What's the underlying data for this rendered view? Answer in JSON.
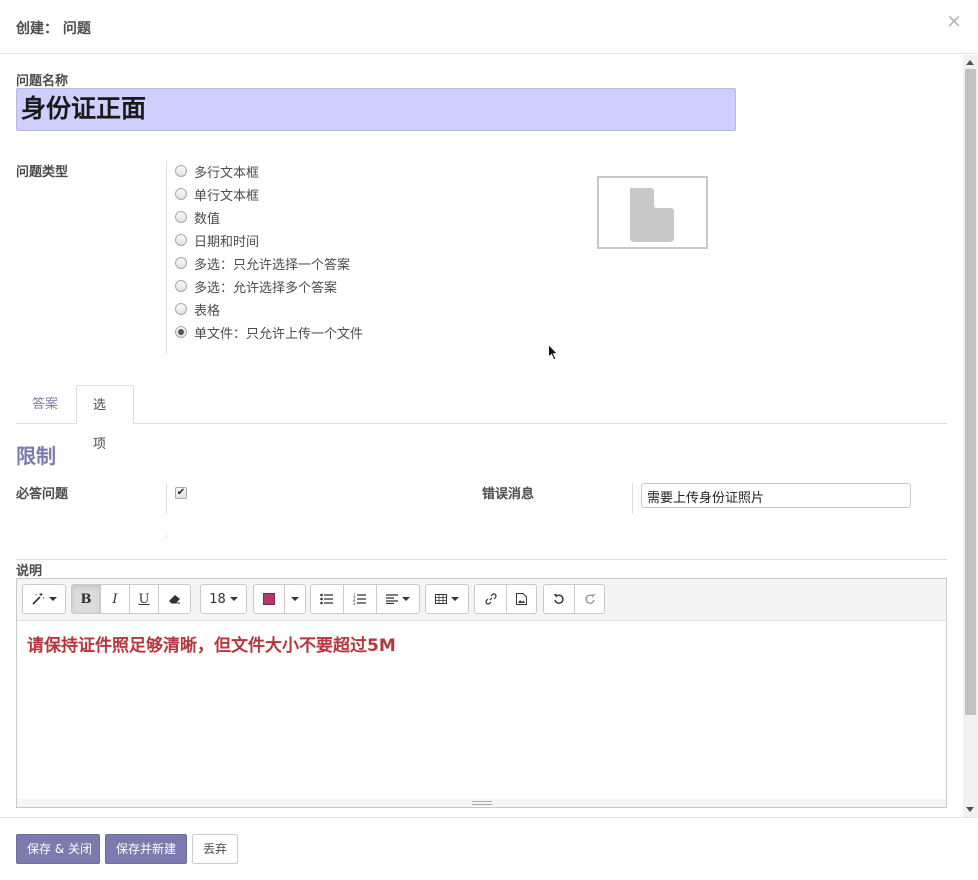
{
  "dialog": {
    "title": "创建： 问题",
    "close_glyph": "×"
  },
  "form": {
    "question_name_label": "问题名称",
    "question_name_value": "身份证正面",
    "question_type_label": "问题类型",
    "question_types": [
      {
        "label": "多行文本框",
        "checked": false
      },
      {
        "label": "单行文本框",
        "checked": false
      },
      {
        "label": "数值",
        "checked": false
      },
      {
        "label": "日期和时间",
        "checked": false
      },
      {
        "label": "多选：只允许选择一个答案",
        "checked": false
      },
      {
        "label": "多选：允许选择多个答案",
        "checked": false
      },
      {
        "label": "表格",
        "checked": false
      },
      {
        "label": "单文件：只允许上传一个文件",
        "checked": true
      }
    ],
    "image_placeholder_icon": "file-icon"
  },
  "tabs": [
    {
      "label": "答案",
      "active": false
    },
    {
      "label": "选项",
      "active": true
    }
  ],
  "options": {
    "section_title": "限制",
    "required_label": "必答问题",
    "required_checked": true,
    "error_message_label": "错误消息",
    "error_message_value": "需要上传身份证照片"
  },
  "description": {
    "label": "说明",
    "font_size": "18",
    "text": "请保持证件照足够清晰，但文件大小不要超过5M",
    "text_color": "#b5373d"
  },
  "footer": {
    "save_close": "保存 & 关闭",
    "save_new": "保存并新建",
    "discard": "丢弃"
  },
  "theme": {
    "primary": "#7c7bad",
    "name_field_bg": "#cfcffd"
  }
}
